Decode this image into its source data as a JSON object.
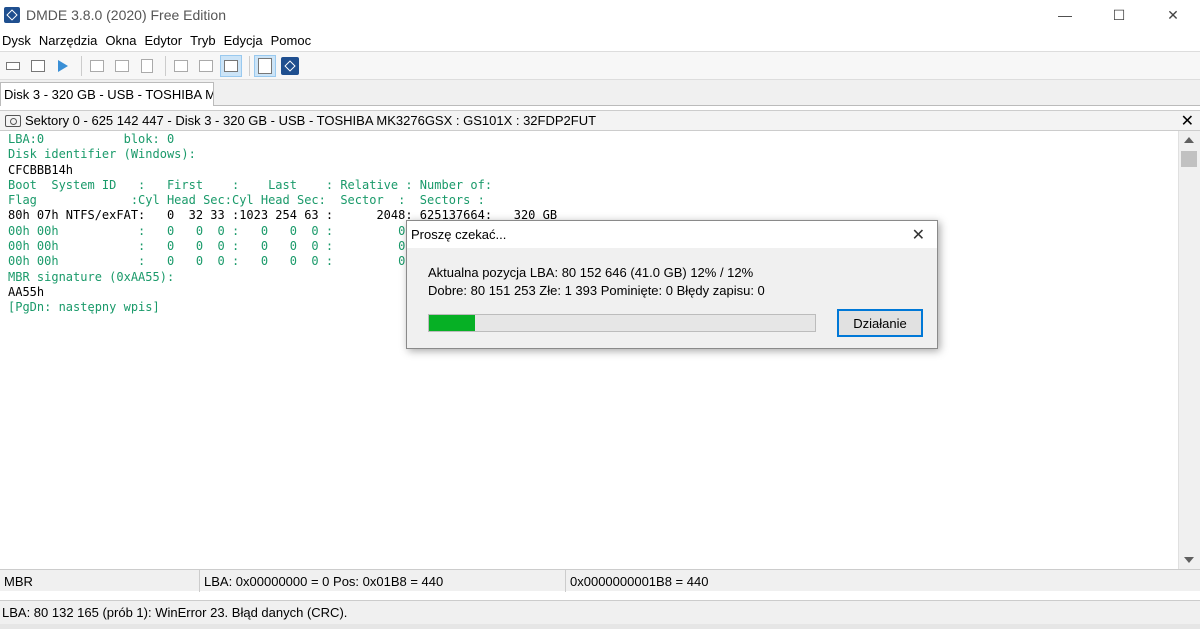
{
  "window": {
    "title": "DMDE 3.8.0 (2020) Free Edition",
    "minimize": "—",
    "maximize": "☐",
    "close": "✕"
  },
  "menu": [
    "Dysk",
    "Narzędzia",
    "Okna",
    "Edytor",
    "Tryb",
    "Edycja",
    "Pomoc"
  ],
  "doc_tab": {
    "label": "Disk 3 - 320 GB - USB - TOSHIBA M..."
  },
  "panel": {
    "title": "Sektory 0 - 625 142 447 - Disk 3 - 320 GB - USB - TOSHIBA MK3276GSX : GS101X : 32FDP2FUT",
    "close": "✕"
  },
  "content": {
    "lines": [
      "LBA:0           blok: 0",
      "Disk identifier (Windows):",
      "CFCBBB14h",
      "Boot  System ID   :   First    :    Last    : Relative : Number of:",
      "Flag             :Cyl Head Sec:Cyl Head Sec:  Sector  :  Sectors :",
      "80h 07h NTFS/exFAT:   0  32 33 :1023 254 63 :      2048: 625137664:   320 GB",
      "00h 00h           :   0   0  0 :   0   0  0 :         0:",
      "00h 00h           :   0   0  0 :   0   0  0 :         0:",
      "00h 00h           :   0   0  0 :   0   0  0 :         0:",
      "MBR signature (0xAA55):",
      "AA55h",
      "[PgDn: następny wpis]"
    ]
  },
  "status": {
    "cell1": "MBR",
    "cell2": "LBA: 0x00000000 = 0  Pos: 0x01B8 = 440",
    "cell3": "0x0000000001B8 = 440"
  },
  "message": "LBA: 80 132 165 (prób 1): WinError 23. Błąd danych (CRC).",
  "dialog": {
    "title": "Proszę czekać...",
    "close": "✕",
    "line1": "Aktualna pozycja LBA: 80 152 646 (41.0 GB) 12% / 12%",
    "line2": "Dobre: 80 151 253  Złe: 1 393  Pominięte: 0  Błędy zapisu: 0",
    "progress_percent": 12,
    "button": "Działanie"
  },
  "colors": {
    "accent": "#0078d7",
    "progress": "#06b025",
    "text_green": "#1a9a6a"
  }
}
